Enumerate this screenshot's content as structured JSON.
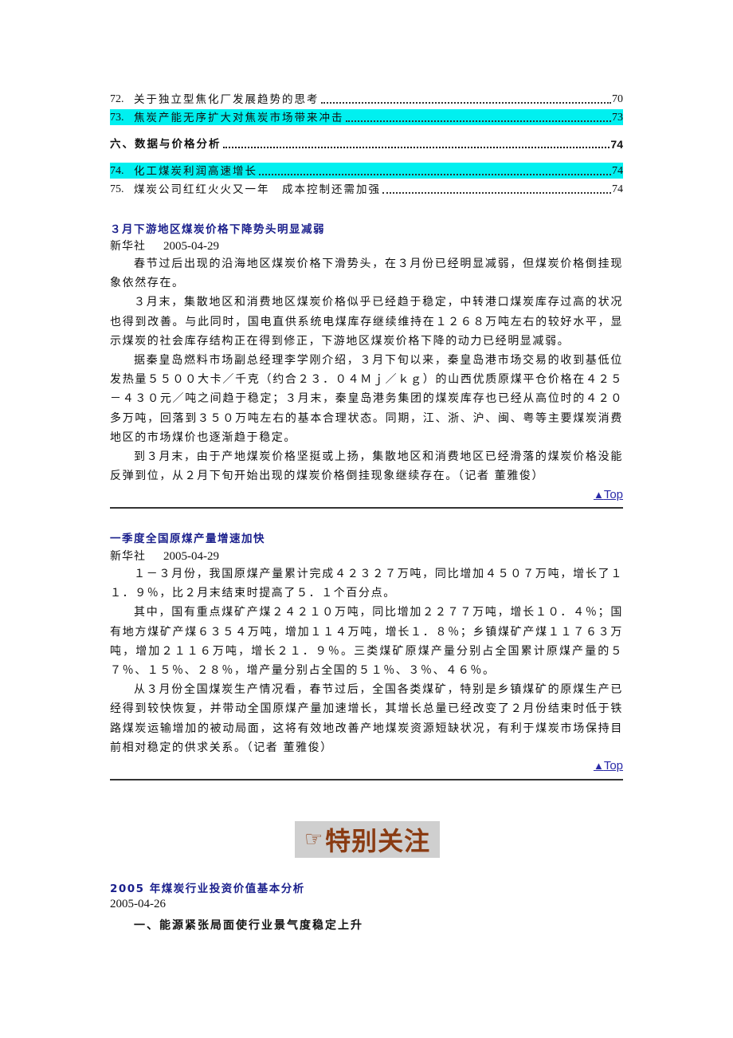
{
  "toc": [
    {
      "num": "72.",
      "title": "关于独立型焦化厂发展趋势的思考",
      "page": "70",
      "highlighted": false
    },
    {
      "num": "73.",
      "title": "焦炭产能无序扩大对焦炭市场带来冲击",
      "page": "73",
      "highlighted": true
    },
    {
      "num": "",
      "title": "六、数据与价格分析",
      "page": "74",
      "highlighted": false,
      "section": true
    },
    {
      "num": "74.",
      "title": "化工煤炭利润高速增长",
      "page": "74",
      "highlighted": true
    },
    {
      "num": "75.",
      "title": "煤炭公司红红火火又一年　成本控制还需加强",
      "page": "74",
      "highlighted": false
    }
  ],
  "articles": [
    {
      "title": "３月下游地区煤炭价格下降势头明显减弱",
      "source": "新华社",
      "date": "2005-04-29",
      "paragraphs": [
        "春节过后出现的沿海地区煤炭价格下滑势头，在３月份已经明显减弱，但煤炭价格倒挂现象依然存在。",
        "３月末，集散地区和消费地区煤炭价格似乎已经趋于稳定，中转港口煤炭库存过高的状况也得到改善。与此同时，国电直供系统电煤库存继续维持在１２６８万吨左右的较好水平，显示煤炭的社会库存结构正在得到修正，下游地区煤炭价格下降的动力已经明显减弱。",
        "据秦皇岛燃料市场副总经理李学刚介绍，３月下旬以来，秦皇岛港市场交易的收到基低位发热量５５００大卡／千克（约合２３．０４Ｍｊ／ｋｇ）的山西优质原煤平仓价格在４２５－４３０元／吨之间趋于稳定；３月末，秦皇岛港务集团的煤炭库存也已经从高位时的４２０多万吨，回落到３５０万吨左右的基本合理状态。同期，江、浙、沪、闽、粤等主要煤炭消费地区的市场煤价也逐渐趋于稳定。",
        "到３月末，由于产地煤炭价格坚挺或上扬，集散地区和消费地区已经滑落的煤炭价格没能反弹到位，从２月下旬开始出现的煤炭价格倒挂现象继续存在。（记者 董雅俊）"
      ],
      "top_label": "Top"
    },
    {
      "title": "一季度全国原煤产量增速加快",
      "source": "新华社",
      "date": "2005-04-29",
      "paragraphs": [
        "１－３月份，我国原煤产量累计完成４２３２７万吨，同比增加４５０７万吨，增长了１１．９％，比２月末结束时提高了５．１个百分点。",
        "其中，国有重点煤矿产煤２４２１０万吨，同比增加２２７７万吨，增长１０．４％；国有地方煤矿产煤６３５４万吨，增加１１４万吨，增长１．８％；乡镇煤矿产煤１１７６３万吨，增加２１１６万吨，增长２１．９％。三类煤矿原煤产量分别占全国累计原煤产量的５７％、１５％、２８％，增产量分别占全国的５１％、３％、４６％。",
        "从３月份全国煤炭生产情况看，春节过后，全国各类煤矿，特别是乡镇煤矿的原煤生产已经得到较快恢复，并带动全国原煤产量加速增长，其增长总量已经改变了２月份结束时低于铁路煤炭运输增加的被动局面，这将有效地改善产地煤炭资源短缺状况，有利于煤炭市场保持目前相对稳定的供求关系。（记者 董雅俊）"
      ],
      "top_label": "Top"
    }
  ],
  "special": {
    "banner_label": "特别关注",
    "banner_icon": "pointing-hand-icon",
    "title": "2005 年煤炭行业投资价值基本分析",
    "date": "2005-04-26",
    "subheading": "一、能源紧张局面使行业景气度稳定上升"
  },
  "colors": {
    "highlight": "#00f0f0",
    "heading_blue": "#1a1f8c",
    "link_blue": "#2a2aa8",
    "banner_bg": "#cfcfcf",
    "banner_text": "#8a3b12"
  }
}
